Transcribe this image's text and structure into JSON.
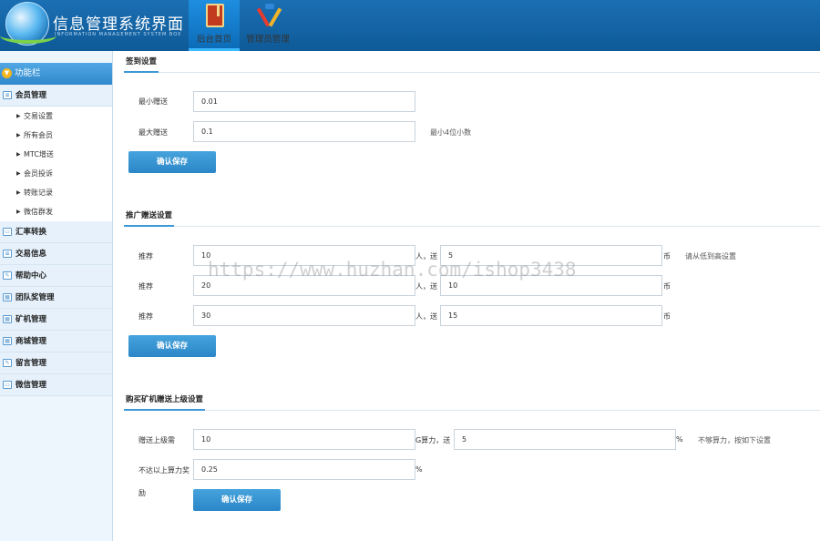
{
  "header": {
    "title": "信息管理系统界面",
    "subtitle": "INFORMATION MANAGEMENT SYSTEM BOX",
    "tabs": [
      {
        "label": "后台首页",
        "icon": "book-icon",
        "active": true
      },
      {
        "label": "管理员管理",
        "icon": "tools-icon",
        "active": false
      }
    ]
  },
  "sidebar": {
    "head": "功能栏",
    "groups": [
      {
        "label": "会员管理",
        "icon": "list-icon",
        "items": [
          "交易设置",
          "所有会员",
          "MTC增送",
          "会员投诉",
          "转账记录",
          "微信群发"
        ]
      },
      {
        "label": "汇率转换",
        "icon": "chat-icon"
      },
      {
        "label": "交易信息",
        "icon": "list-icon"
      },
      {
        "label": "帮助中心",
        "icon": "edit-icon"
      },
      {
        "label": "团队奖管理",
        "icon": "calendar-icon"
      },
      {
        "label": "矿机管理",
        "icon": "calendar-icon"
      },
      {
        "label": "商城管理",
        "icon": "calendar-icon"
      },
      {
        "label": "留言管理",
        "icon": "edit-icon"
      },
      {
        "label": "微信管理",
        "icon": "chat-icon"
      }
    ]
  },
  "sign": {
    "title": "签到设置",
    "min_label": "最小赠送",
    "min_value": "0.01",
    "max_label": "最大赠送",
    "max_value": "0.1",
    "hint": "最小4位小数",
    "save": "确认保存"
  },
  "promo": {
    "title": "推广赠送设置",
    "rows": [
      {
        "label": "推荐",
        "people": "10",
        "mid": "人，送",
        "coins": "5",
        "unit": "币"
      },
      {
        "label": "推荐",
        "people": "20",
        "mid": "人，送",
        "coins": "10",
        "unit": "币"
      },
      {
        "label": "推荐",
        "people": "30",
        "mid": "人，送",
        "coins": "15",
        "unit": "币"
      }
    ],
    "hint": "请从低到高设置",
    "save": "确认保存"
  },
  "miner": {
    "title": "购买矿机赠送上级设置",
    "row1_label": "赠送上级需",
    "row1_value": "10",
    "row1_mid": "G算力，送",
    "row1_value2": "5",
    "row1_unit": "%",
    "row1_hint": "不够算力，按如下设置",
    "row2_label_a": "不达以上算力奖",
    "row2_label_b": "励",
    "row2_value": "0.25",
    "row2_unit": "%",
    "save": "确认保存"
  },
  "watermark": "https://www.huzhan.com/ishop3438"
}
